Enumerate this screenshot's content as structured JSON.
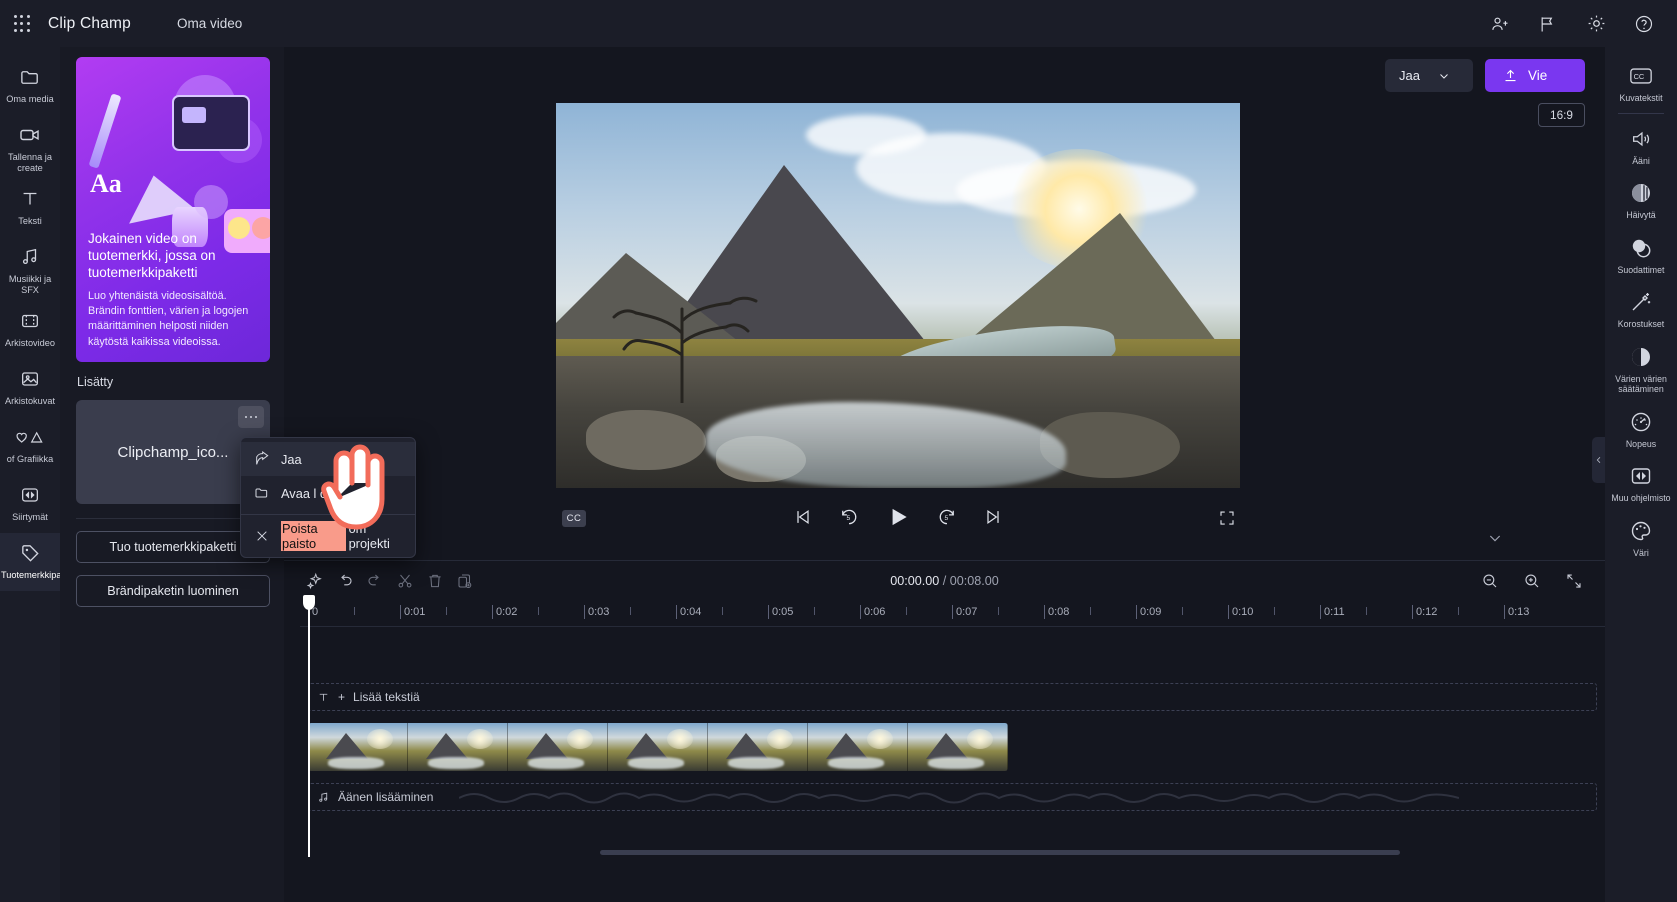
{
  "topbar": {
    "waffle_icon": "app-launcher-icon",
    "brand": "Clip Champ",
    "project_name": "Oma video",
    "icons": [
      {
        "name": "collaborate-icon"
      },
      {
        "name": "flag-feedback-icon"
      },
      {
        "name": "settings-gear-icon"
      },
      {
        "name": "help-icon"
      }
    ]
  },
  "left_rail": {
    "items": [
      {
        "label": "Oma media",
        "icon": "folder-icon",
        "active": false
      },
      {
        "label": "Tallenna ja create",
        "icon": "camera-icon",
        "active": false
      },
      {
        "label": "Teksti",
        "icon": "text-icon",
        "active": false
      },
      {
        "label": "Musiikki ja SFX",
        "icon": "music-icon",
        "active": false
      },
      {
        "label": "Arkistovideo",
        "icon": "film-icon",
        "active": false
      },
      {
        "label": "Arkistokuvat",
        "icon": "image-icon",
        "active": false
      },
      {
        "label": "of Grafiikka",
        "icon": "shapes-icon",
        "active": false
      },
      {
        "label": "Siirtymät",
        "icon": "transitions-icon",
        "active": false
      },
      {
        "label": "Tuotemerkkipaketti",
        "icon": "brandkit-tag-icon",
        "active": true
      }
    ]
  },
  "panel": {
    "promo": {
      "title": "Jokainen video on tuotemerkki, jossa on tuotemerkkipaketti",
      "body": "Luo yhtenäistä videosisältöä. Brändin fonttien, värien ja logojen määrittäminen helposti niiden käytöstä kaikissa videoissa.",
      "aa_glyph": "Aa"
    },
    "section_label": "Lisätty",
    "media_card": {
      "name": "Clipchamp_ico...",
      "more_icon": "more-options-icon"
    },
    "buttons": [
      {
        "label": "Tuo tuotemerkkipaketti"
      },
      {
        "label": "Brändipaketin luominen"
      }
    ]
  },
  "context_menu": {
    "items": [
      {
        "label": "Jaa",
        "icon": "share-icon",
        "hovered": true,
        "highlight": ""
      },
      {
        "label": "Avaa l oca",
        "icon": "folder-icon",
        "hovered": false,
        "highlight": ""
      },
      {
        "label": "om projekti",
        "icon": "close-x-icon",
        "hovered": false,
        "highlight": "Poista paisto"
      }
    ]
  },
  "stage": {
    "share_button": {
      "label": "Jaa",
      "chevron_icon": "chevron-down-icon"
    },
    "export_button": {
      "label": "Vie",
      "icon": "upload-icon"
    },
    "aspect_ratio": "16:9",
    "collapse_icon": "chevron-left-icon",
    "controls": {
      "cc_label": "CC",
      "skip_back_icon": "skip-to-start-icon",
      "back5_icon": "rewind-5-icon",
      "play_icon": "play-icon",
      "fwd5_icon": "forward-5-icon",
      "skip_fwd_icon": "skip-to-end-icon",
      "fullscreen_icon": "fullscreen-icon"
    }
  },
  "right_rail": {
    "items": [
      {
        "label": "Kuvatekstit",
        "icon": "closed-captions-icon",
        "sep_after": true
      },
      {
        "label": "Ääni",
        "icon": "speaker-icon",
        "sep_after": false
      },
      {
        "label": "Häivytä",
        "icon": "fade-icon",
        "sep_after": false
      },
      {
        "label": "Suodattimet",
        "icon": "filters-icon",
        "sep_after": false
      },
      {
        "label": "Korostukset",
        "icon": "magic-wand-icon",
        "sep_after": false
      },
      {
        "label": "Värien värien säätäminen",
        "icon": "color-adjust-icon",
        "sep_after": false
      },
      {
        "label": "Nopeus",
        "icon": "speed-gauge-icon",
        "sep_after": false
      },
      {
        "label": "Muu ohjelmisto",
        "icon": "transitions-icon",
        "sep_after": false
      },
      {
        "label": "Väri",
        "icon": "palette-icon",
        "sep_after": false
      }
    ]
  },
  "timeline": {
    "tools": [
      {
        "name": "magic-sparkle-icon",
        "dim": false
      },
      {
        "name": "undo-icon",
        "dim": false
      },
      {
        "name": "redo-icon",
        "dim": true
      },
      {
        "name": "split-scissors-icon",
        "dim": true
      },
      {
        "name": "delete-trash-icon",
        "dim": true
      },
      {
        "name": "duplicate-icon",
        "dim": true
      }
    ],
    "current_time": "00:00.00",
    "separator": " / ",
    "total_time": "00:08.00",
    "zoom_tools": [
      {
        "name": "zoom-out-icon"
      },
      {
        "name": "zoom-in-icon"
      },
      {
        "name": "fit-to-screen-icon"
      }
    ],
    "ruler_labels": [
      "0",
      "0:01",
      "0:02",
      "0:03",
      "0:04",
      "0:05",
      "0:06",
      "0:07",
      "0:08",
      "0:09",
      "0:10",
      "0:11",
      "0:12",
      "0:13"
    ],
    "text_track": {
      "label": "Lisää tekstiä",
      "icon": "text-icon",
      "plus": "+"
    },
    "audio_track": {
      "label": "Äänen lisääminen",
      "icon": "music-note-icon"
    },
    "video_clip_thumbs": 7
  }
}
